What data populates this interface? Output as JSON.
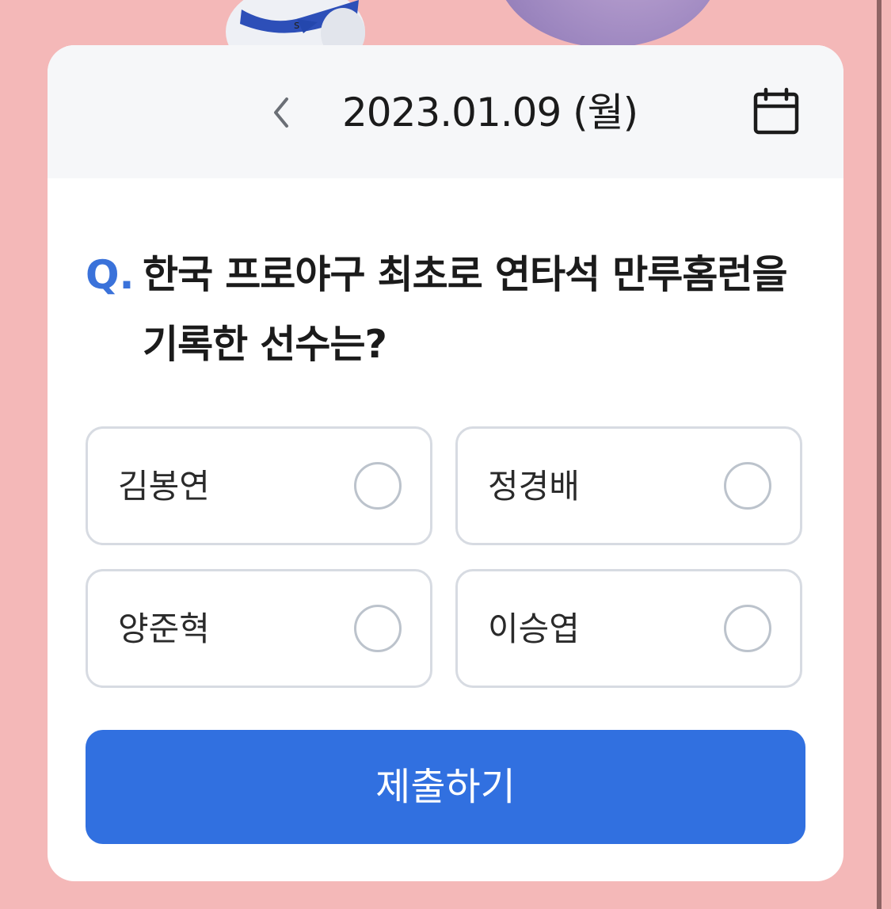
{
  "header": {
    "date": "2023.01.09 (월)",
    "prev_icon": "chevron-left-icon",
    "calendar_icon": "calendar-icon"
  },
  "question": {
    "marker": "Q.",
    "text": "한국 프로야구 최초로 연타석 만루홈런을 기록한 선수는?"
  },
  "options": [
    {
      "label": "김봉연",
      "selected": false
    },
    {
      "label": "정경배",
      "selected": false
    },
    {
      "label": "양준혁",
      "selected": false
    },
    {
      "label": "이승엽",
      "selected": false
    }
  ],
  "submit": {
    "label": "제출하기"
  },
  "colors": {
    "background": "#f4b8b8",
    "accent": "#3170e0",
    "question_marker": "#3a72da",
    "header_bg": "#f6f7f9",
    "option_border": "#d7dbe2"
  }
}
